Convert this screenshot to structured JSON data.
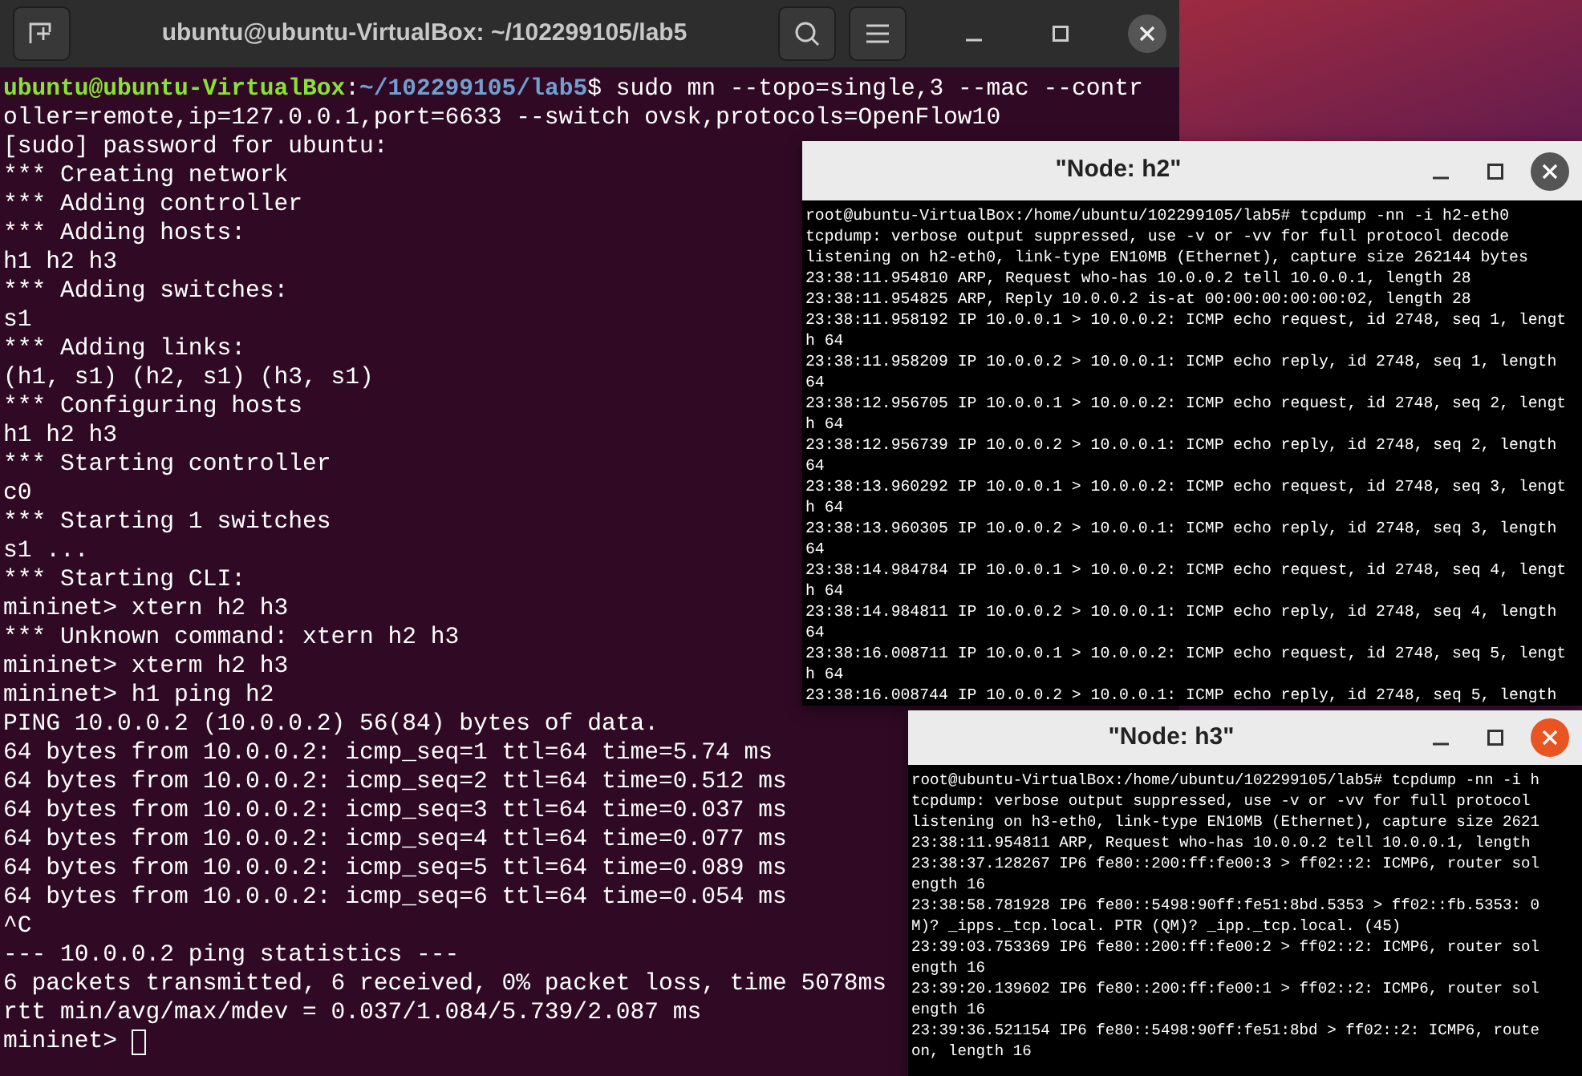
{
  "terminal": {
    "title": "ubuntu@ubuntu-VirtualBox: ~/102299105/lab5",
    "prompt": {
      "user": "ubuntu@ubuntu-VirtualBox",
      "separator": ":",
      "path": "~/102299105/lab5",
      "command": "$ sudo mn --topo=single,3 --mac --contr"
    },
    "lines": [
      "oller=remote,ip=127.0.0.1,port=6633 --switch ovsk,protocols=OpenFlow10",
      "[sudo] password for ubuntu:",
      "*** Creating network",
      "*** Adding controller",
      "*** Adding hosts:",
      "h1 h2 h3",
      "*** Adding switches:",
      "s1",
      "*** Adding links:",
      "(h1, s1) (h2, s1) (h3, s1)",
      "*** Configuring hosts",
      "h1 h2 h3",
      "*** Starting controller",
      "c0",
      "*** Starting 1 switches",
      "s1 ...",
      "*** Starting CLI:",
      "mininet> xtern h2 h3",
      "*** Unknown command: xtern h2 h3",
      "mininet> xterm h2 h3",
      "mininet> h1 ping h2",
      "PING 10.0.0.2 (10.0.0.2) 56(84) bytes of data.",
      "64 bytes from 10.0.0.2: icmp_seq=1 ttl=64 time=5.74 ms",
      "64 bytes from 10.0.0.2: icmp_seq=2 ttl=64 time=0.512 ms",
      "64 bytes from 10.0.0.2: icmp_seq=3 ttl=64 time=0.037 ms",
      "64 bytes from 10.0.0.2: icmp_seq=4 ttl=64 time=0.077 ms",
      "64 bytes from 10.0.0.2: icmp_seq=5 ttl=64 time=0.089 ms",
      "64 bytes from 10.0.0.2: icmp_seq=6 ttl=64 time=0.054 ms",
      "^C",
      "--- 10.0.0.2 ping statistics ---",
      "6 packets transmitted, 6 received, 0% packet loss, time 5078ms",
      "rtt min/avg/max/mdev = 0.037/1.084/5.739/2.087 ms"
    ],
    "input_prompt": "mininet>"
  },
  "xterms": [
    {
      "title": "\"Node: h2\"",
      "close_highlighted": false,
      "lines": [
        "root@ubuntu-VirtualBox:/home/ubuntu/102299105/lab5# tcpdump -nn -i h2-eth0",
        "tcpdump: verbose output suppressed, use -v or -vv for full protocol decode",
        "listening on h2-eth0, link-type EN10MB (Ethernet), capture size 262144 bytes",
        "23:38:11.954810 ARP, Request who-has 10.0.0.2 tell 10.0.0.1, length 28",
        "23:38:11.954825 ARP, Reply 10.0.0.2 is-at 00:00:00:00:00:02, length 28",
        "23:38:11.958192 IP 10.0.0.1 > 10.0.0.2: ICMP echo request, id 2748, seq 1, lengt",
        "h 64",
        "23:38:11.958209 IP 10.0.0.2 > 10.0.0.1: ICMP echo reply, id 2748, seq 1, length",
        "64",
        "23:38:12.956705 IP 10.0.0.1 > 10.0.0.2: ICMP echo request, id 2748, seq 2, lengt",
        "h 64",
        "23:38:12.956739 IP 10.0.0.2 > 10.0.0.1: ICMP echo reply, id 2748, seq 2, length",
        "64",
        "23:38:13.960292 IP 10.0.0.1 > 10.0.0.2: ICMP echo request, id 2748, seq 3, lengt",
        "h 64",
        "23:38:13.960305 IP 10.0.0.2 > 10.0.0.1: ICMP echo reply, id 2748, seq 3, length",
        "64",
        "23:38:14.984784 IP 10.0.0.1 > 10.0.0.2: ICMP echo request, id 2748, seq 4, lengt",
        "h 64",
        "23:38:14.984811 IP 10.0.0.2 > 10.0.0.1: ICMP echo reply, id 2748, seq 4, length",
        "64",
        "23:38:16.008711 IP 10.0.0.1 > 10.0.0.2: ICMP echo request, id 2748, seq 5, lengt",
        "h 64",
        "23:38:16.008744 IP 10.0.0.2 > 10.0.0.1: ICMP echo reply, id 2748, seq 5, length"
      ]
    },
    {
      "title": "\"Node: h3\"",
      "close_highlighted": true,
      "lines": [
        "root@ubuntu-VirtualBox:/home/ubuntu/102299105/lab5# tcpdump -nn -i h",
        "tcpdump: verbose output suppressed, use -v or -vv for full protocol",
        "listening on h3-eth0, link-type EN10MB (Ethernet), capture size 2621",
        "23:38:11.954811 ARP, Request who-has 10.0.0.2 tell 10.0.0.1, length",
        "23:38:37.128267 IP6 fe80::200:ff:fe00:3 > ff02::2: ICMP6, router sol",
        "ength 16",
        "23:38:58.781928 IP6 fe80::5498:90ff:fe51:8bd.5353 > ff02::fb.5353: 0",
        "M)? _ipps._tcp.local. PTR (QM)? _ipp._tcp.local. (45)",
        "23:39:03.753369 IP6 fe80::200:ff:fe00:2 > ff02::2: ICMP6, router sol",
        "ength 16",
        "23:39:20.139602 IP6 fe80::200:ff:fe00:1 > ff02::2: ICMP6, router sol",
        "ength 16",
        "23:39:36.521154 IP6 fe80::5498:90ff:fe51:8bd > ff02::2: ICMP6, route",
        "on, length 16"
      ]
    }
  ]
}
